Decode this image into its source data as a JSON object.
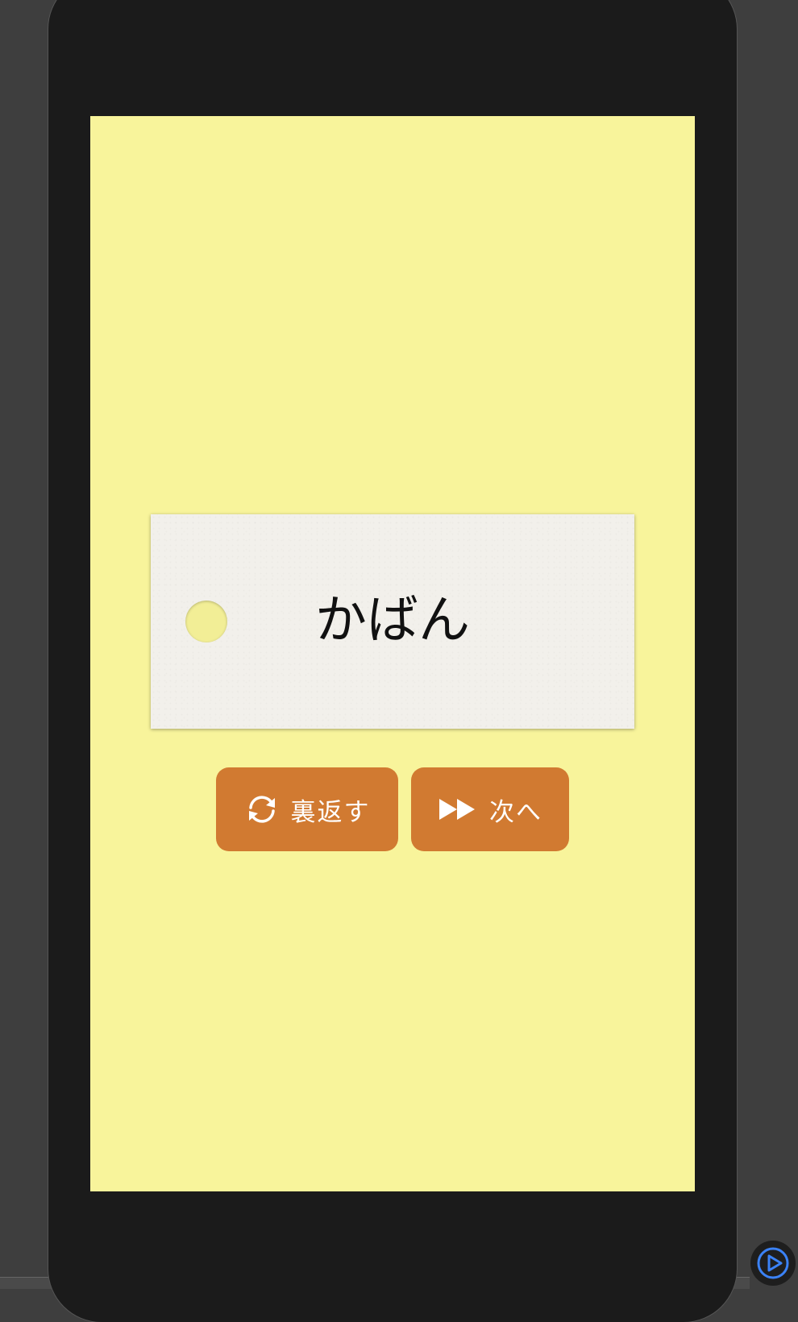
{
  "card": {
    "word": "かばん"
  },
  "buttons": {
    "flip_label": "裏返す",
    "flip_icon": "refresh-icon",
    "next_label": "次へ",
    "next_icon": "fast-forward-icon"
  },
  "overlay": {
    "play_icon": "play-circle-icon"
  },
  "colors": {
    "screen_bg": "#f8f49b",
    "button_bg": "#d17a31",
    "card_bg": "#f2f0eb",
    "phone_frame": "#1b1b1b"
  }
}
